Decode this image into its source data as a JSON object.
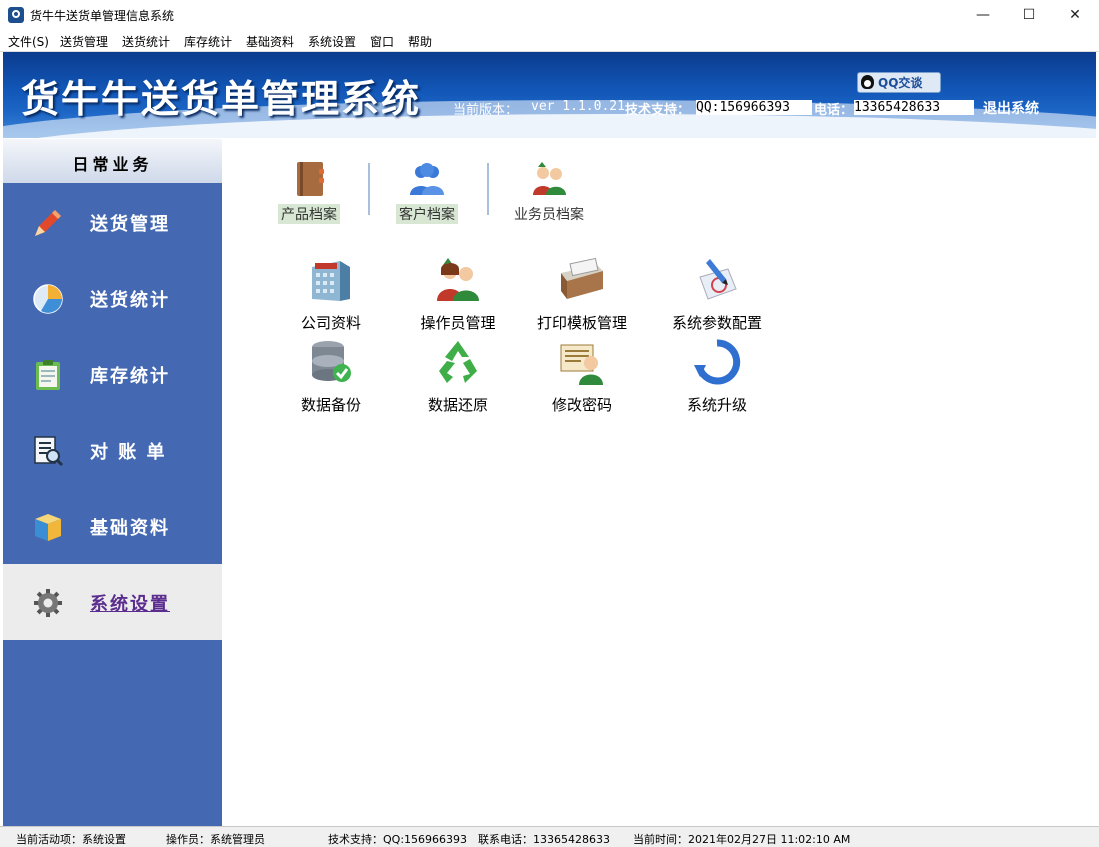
{
  "window": {
    "title": "货牛牛送货单管理信息系统"
  },
  "menu": [
    "文件(S)",
    "送货管理",
    "送货统计",
    "库存统计",
    "基础资料",
    "系统设置",
    "窗口",
    "帮助"
  ],
  "banner": {
    "title": "货牛牛送货单管理系统",
    "version_label": "当前版本：",
    "version": "ver 1.1.0.21",
    "support_label": "技术支持：",
    "support_value": "QQ:156966393",
    "phone_label": "电话：",
    "phone_value": "13365428633",
    "logout": "退出系统",
    "qq_button": "QQ交谈"
  },
  "sidebar": {
    "header": "日常业务",
    "items": [
      {
        "label": "送货管理",
        "icon": "pencil-icon"
      },
      {
        "label": "送货统计",
        "icon": "pie-chart-icon"
      },
      {
        "label": "库存统计",
        "icon": "clipboard-icon"
      },
      {
        "label": "对 账 单",
        "icon": "document-search-icon"
      },
      {
        "label": "基础资料",
        "icon": "box-icon"
      },
      {
        "label": "系统设置",
        "icon": "gear-icon",
        "active": true
      }
    ]
  },
  "content": {
    "top_tools": [
      {
        "label": "产品档案",
        "icon": "book-icon"
      },
      {
        "label": "客户档案",
        "icon": "user-icon"
      },
      {
        "label": "业务员档案",
        "icon": "salesperson-icon"
      }
    ],
    "tools": [
      {
        "label": "公司资料",
        "icon": "company-icon"
      },
      {
        "label": "操作员管理",
        "icon": "operator-icon"
      },
      {
        "label": "打印模板管理",
        "icon": "print-template-icon"
      },
      {
        "label": "系统参数配置",
        "icon": "settings-pen-icon"
      },
      {
        "label": "数据备份",
        "icon": "database-backup-icon"
      },
      {
        "label": "数据还原",
        "icon": "recycle-icon"
      },
      {
        "label": "修改密码",
        "icon": "change-password-icon"
      },
      {
        "label": "系统升级",
        "icon": "upgrade-icon"
      }
    ]
  },
  "status": {
    "active_item": "当前活动项：系统设置",
    "operator": "操作员：系统管理员",
    "support": "技术支持：QQ:156966393",
    "phone": "联系电话：13365428633",
    "time": "当前时间：2021年02月27日 11:02:10 AM"
  },
  "colors": {
    "sidebar": "#4469b2",
    "banner": "#1257b8",
    "active_label": "#5b2d8e"
  }
}
